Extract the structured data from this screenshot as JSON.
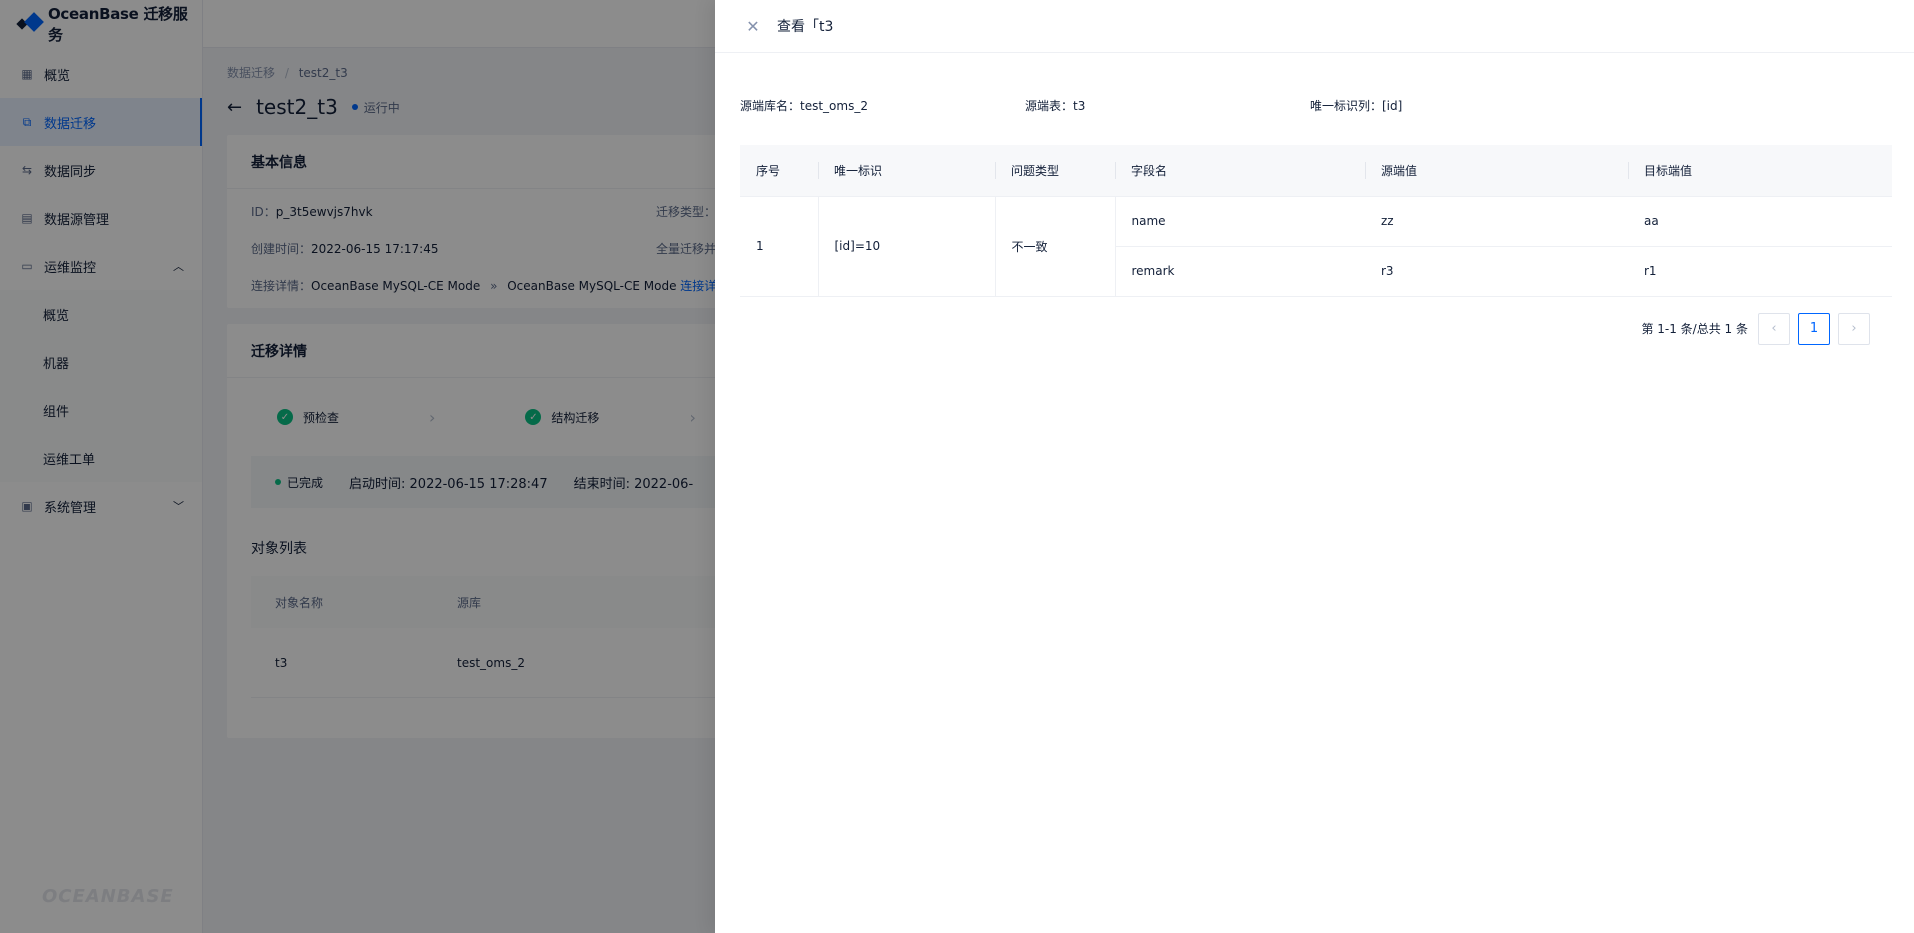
{
  "app": {
    "title": "OceanBase 迁移服务",
    "footer_logo": "OCEANBASE"
  },
  "sidebar": {
    "items": [
      {
        "label": "概览",
        "icon": "grid-icon"
      },
      {
        "label": "数据迁移",
        "icon": "migration-icon",
        "active": true
      },
      {
        "label": "数据同步",
        "icon": "sync-icon"
      },
      {
        "label": "数据源管理",
        "icon": "datasource-icon"
      },
      {
        "label": "运维监控",
        "icon": "monitor-icon",
        "expanded": true
      },
      {
        "label": "系统管理",
        "icon": "system-icon"
      }
    ],
    "sub_items": [
      "概览",
      "机器",
      "组件",
      "运维工单"
    ]
  },
  "main": {
    "breadcrumb": [
      "数据迁移",
      "test2_t3"
    ],
    "title": "test2_t3",
    "status": "运行中",
    "basic_info": {
      "heading": "基本信息",
      "id_label": "ID：",
      "id_value": "p_3t5ewvjs7hvk",
      "type_label": "迁移类型：",
      "created_label": "创建时间：",
      "created_value": "2022-06-15 17:17:45",
      "full_label": "全量迁移并",
      "conn_label": "连接详情：",
      "conn_src": "OceanBase MySQL-CE Mode",
      "conn_arrow": "»",
      "conn_dst": "OceanBase MySQL-CE Mode",
      "conn_link": "连接详情"
    },
    "migration": {
      "heading": "迁移详情",
      "steps": [
        "预检查",
        "结构迁移"
      ],
      "done_status": "已完成",
      "start_time": "启动时间: 2022-06-15 17:28:47",
      "end_time": "结束时间: 2022-06-"
    },
    "objects": {
      "heading": "对象列表",
      "columns": [
        "对象名称",
        "源库"
      ],
      "rows": [
        {
          "name": "t3",
          "db": "test_oms_2"
        }
      ]
    }
  },
  "drawer": {
    "title": "查看「t3",
    "meta": {
      "source_db": "源端库名：test_oms_2",
      "source_table": "源端表：t3",
      "unique_col": "唯一标识列：[id]"
    },
    "table": {
      "columns": [
        "序号",
        "唯一标识",
        "问题类型",
        "字段名",
        "源端值",
        "目标端值"
      ],
      "group": {
        "index": "1",
        "key": "[id]=10",
        "issue": "不一致"
      },
      "rows": [
        {
          "field": "name",
          "source": "zz",
          "target": "aa"
        },
        {
          "field": "remark",
          "source": "r3",
          "target": "r1"
        }
      ]
    },
    "pagination": {
      "summary": "第 1-1 条/总共 1 条",
      "current": "1"
    }
  },
  "colors": {
    "primary": "#0066ff",
    "success": "#0ac185",
    "running": "#0066ff"
  }
}
